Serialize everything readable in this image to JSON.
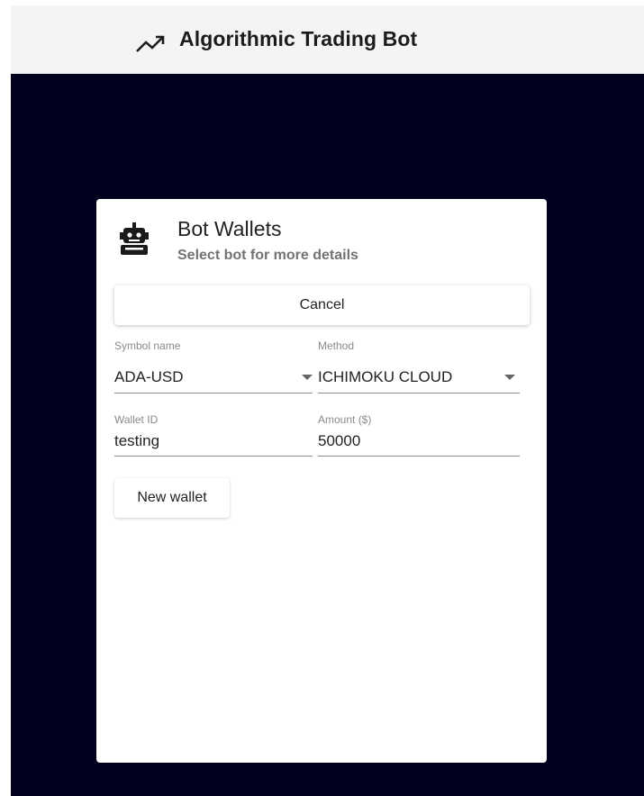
{
  "header": {
    "title": "Algorithmic Trading Bot",
    "icon": "trending-up-icon"
  },
  "colors": {
    "header_bg": "#f4f4f4",
    "main_bg": "#01011d",
    "card_bg": "#ffffff",
    "text": "#222222",
    "muted": "#737373"
  },
  "card": {
    "icon": "robot-icon",
    "title": "Bot Wallets",
    "subtitle": "Select bot for more details",
    "cancel_label": "Cancel",
    "symbol": {
      "label": "Symbol name",
      "value": "ADA-USD"
    },
    "method": {
      "label": "Method",
      "value": "ICHIMOKU CLOUD"
    },
    "wallet_id": {
      "label": "Wallet ID",
      "value": "testing"
    },
    "amount": {
      "label": "Amount ($)",
      "value": "50000"
    },
    "new_wallet_label": "New wallet"
  }
}
